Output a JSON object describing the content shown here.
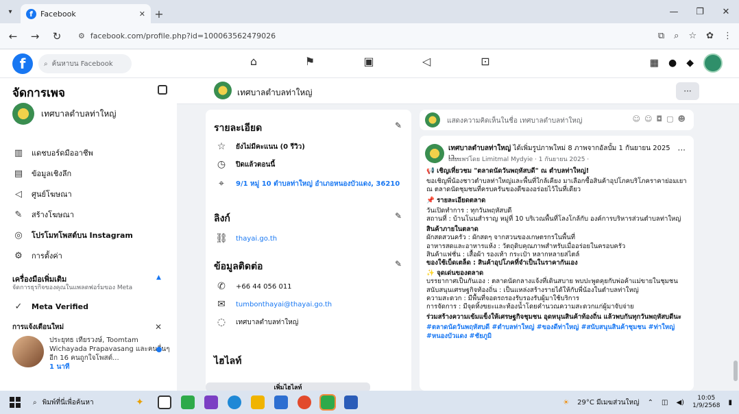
{
  "browser": {
    "tab_title": "Facebook",
    "url": "facebook.com/profile.php?id=100063562479026"
  },
  "fb": {
    "search_placeholder": "ค้นหาบน Facebook"
  },
  "sidebar": {
    "title": "จัดการเพจ",
    "page_name": "เทศบาลตำบลท่าใหญ่",
    "items": [
      {
        "icon": "dashboard-icon",
        "label": "แดชบอร์ดมืออาชีพ"
      },
      {
        "icon": "insights-icon",
        "label": "ข้อมูลเชิงลึก"
      },
      {
        "icon": "ad-center-icon",
        "label": "ศูนย์โฆษณา"
      },
      {
        "icon": "create-ad-icon",
        "label": "สร้างโฆษณา"
      },
      {
        "icon": "instagram-icon",
        "label": "โปรโมทโพสต์บน Instagram"
      },
      {
        "icon": "settings-icon",
        "label": "การตั้งค่า"
      }
    ],
    "tools_title": "เครื่องมือเพิ่มเติม",
    "tools_sub": "จัดการธุรกิจของคุณในแพลตฟอร์มของ Meta",
    "meta_verified": "Meta Verified",
    "notif_title": "การแจ้งเตือนใหม่",
    "notif_text": "ประยุทธ เทียรวงษ์, Toomtam Wichayada Prapavasang และคนอื่นๆ อีก 16 คนถูกใจโพสต์...",
    "notif_time": "1 นาที"
  },
  "page_header": {
    "name": "เทศบาลตำบลท่าใหญ่"
  },
  "details": {
    "title": "รายละเอียด",
    "rating": "ยังไม่มีคะแนน (0 รีวิว)",
    "status": "ปิดแล้วตอนนี้",
    "address": "9/1 หมู่ 10 ตำบลท่าใหญ่ อำเภอหนองบัวแดง, 36210",
    "links_title": "ลิงก์",
    "website": "thayai.go.th",
    "contact_title": "ข้อมูลติดต่อ",
    "phone": "+66 44 056 011",
    "email": "tumbonthayai@thayai.go.th",
    "messenger": "เทศบาลตำบลท่าใหญ่",
    "highlights_title": "ไฮไลท์",
    "highlights_button": "เพิ่มไฮไลท์"
  },
  "composer": {
    "placeholder": "แสดงความคิดเห็นในชื่อ เทศบาลตำบลท่าใหญ่"
  },
  "post": {
    "author": "เทศบาลตำบลท่าใหญ่",
    "action": " ได้เพิ่มรูปภาพใหม่ 8 ภาพจากอัลบั้ม 1 กันยายน 2025 เว...",
    "meta": "เผยแพร่โดย Limitmal Mydyie · 1 กันยายน 2025 ·",
    "lines": [
      "📢 เชิญเที่ยวชม \"ตลาดนัดวันพฤหัสบดี\" ณ ตำบลท่าใหญ่!",
      "ขอเชิญพี่น้องชาวตำบลท่าใหญ่และพื้นที่ใกล้เคียง มาเลือกซื้อสินค้าอุปโภคบริโภคราคาย่อมเยา ณ ตลาดนัดชุมชนที่ครบครันของดีของอร่อยไว้ในที่เดียว",
      "📌 รายละเอียดตลาด",
      "วันเปิดทำการ : ทุกวันพฤหัสบดี",
      "สถานที่ : บ้านโนนสำราญ หมู่ที่ 10 บริเวณพื้นที่โลงโกล้กับ องค์การบริหารส่วนตำบลท่าใหญ่",
      "สินค้าภายในตลาด",
      "ผักสดสวนครัว : ผักสดๆ จากสวนของเกษตรกรในพื้นที่",
      "อาหารสดและอาหารแห้ง : วัตถุดิบคุณภาพสำหรับเมื่ออร่อยในครอบครัว",
      "สินค้าแฟชั่น : เสื้อผ้า รองเท้า กระเป๋า หลากหลายสไตล์",
      "ของใช้เบ็ดเตล็ด : สินค้าอุปโภคที่จำเป็นในราคากันเอง",
      "✨ จุดเด่นของตลาด",
      "บรรยากาศเป็นกันเอง : ตลาดนัดกลางแจ้งที่เดินสบาย พบปะพูดคุยกับพ่อค้าแม่ขายในชุมชน",
      "สนับสนุนเศรษฐกิจท้องถิ่น : เป็นแหล่งสร้างรายได้ให้กับพี่น้องในตำบลท่าใหญ่",
      "ความสะดวก : มีพื้นที่จอดรถรองรับรองรับผู้มาใช้บริการ",
      "การจัดการ : มีจุดทิ้งขยะและท้องน้ำโดยคำนวณความสะดวกแก่ผู้มาจับจ่าย",
      "ร่วมสร้างความเข้มแข็งให้เศรษฐกิจชุมชน อุดหนุนสินค้าท้องถิ่น แล้วพบกันทุกวันพฤหัสบดีนะ",
      "#ตลาดนัดวันพฤหัสบดี #ตำบลท่าใหญ่ #ของดีท่าใหญ่ #สนับสนุนสินค้าชุมชน #ท่าใหญ่ #หนองบัวแดง #ชัยภูมิ"
    ]
  },
  "taskbar": {
    "search": "พิมพ์ที่นี่เพื่อค้นหา",
    "weather": "29°C มีเมฆส่วนใหญ่",
    "time": "10:05",
    "date": "1/9/2568"
  }
}
